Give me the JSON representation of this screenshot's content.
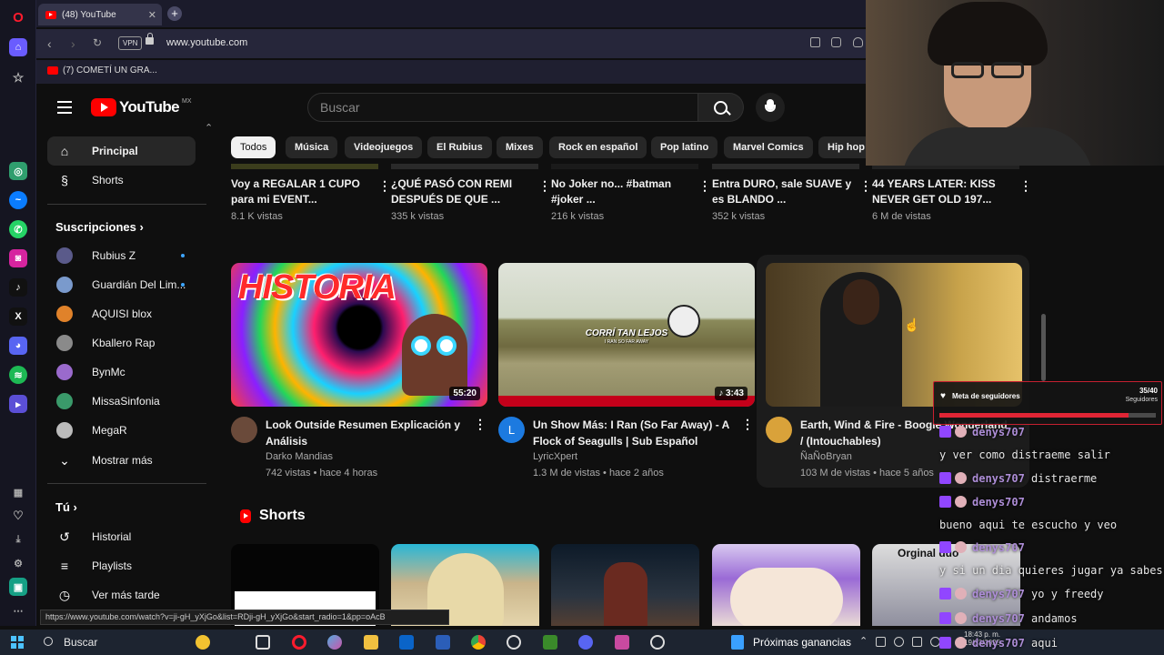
{
  "browser": {
    "tab_title": "(48) YouTube",
    "new_tab": "+",
    "vpn": "VPN",
    "url": "www.youtube.com",
    "bookmark": "(7) COMETÍ UN GRA...",
    "status_url": "https://www.youtube.com/watch?v=ji-gH_yXjGo&list=RDji-gH_yXjGo&start_radio=1&pp=oAcB"
  },
  "masthead": {
    "logo": "YouTube",
    "country": "MX",
    "search_placeholder": "Buscar"
  },
  "guide": {
    "home": "Principal",
    "shorts": "Shorts",
    "subs_header": "Suscripciones",
    "subscriptions": [
      {
        "name": "Rubius Z",
        "color": "#5a5a8a",
        "new": true
      },
      {
        "name": "Guardián Del Lim...",
        "color": "#7a9acc",
        "new": true
      },
      {
        "name": "AQUISI blox",
        "color": "#e0822a",
        "new": false
      },
      {
        "name": "Kballero Rap",
        "color": "#8a8a8a",
        "new": false
      },
      {
        "name": "BynMc",
        "color": "#9a6acc",
        "new": false
      },
      {
        "name": "MissaSinfonia",
        "color": "#3a9a6a",
        "new": false
      },
      {
        "name": "MegaR",
        "color": "#bbbbbb",
        "new": false
      }
    ],
    "show_more": "Mostrar más",
    "you_header": "Tú",
    "history": "Historial",
    "playlists": "Playlists",
    "watch_later": "Ver más tarde"
  },
  "chips": [
    "Todos",
    "Música",
    "Videojuegos",
    "El Rubius",
    "Mixes",
    "Rock en español",
    "Pop latino",
    "Marvel Comics",
    "Hip hop"
  ],
  "row1": [
    {
      "title": "Voy a REGALAR 1 CUPO para mi EVENT...",
      "meta": "8.1 K vistas"
    },
    {
      "title": "¿QUÉ PASÓ CON REMI DESPUÉS DE QUE ...",
      "meta": "335 k vistas"
    },
    {
      "title": "No Joker no... #batman #joker ...",
      "meta": "216 k vistas"
    },
    {
      "title": "Entra DURO, sale SUAVE y es BLANDO ...",
      "meta": "352 k vistas"
    },
    {
      "title": "44 YEARS LATER: KISS NEVER GET OLD 197...",
      "meta": "6 M de vistas"
    }
  ],
  "videos": [
    {
      "title": "Look Outside Resumen Explicación y Análisis",
      "channel": "Darko Mandias",
      "meta": "742 vistas • hace 4 horas",
      "duration": "55:20",
      "thumb_text": "HISTORIA"
    },
    {
      "title": "Un Show Más: I Ran (So Far Away) - A Flock of Seagulls | Sub Español",
      "channel": "LyricXpert",
      "meta": "1.3 M de vistas • hace 2 años",
      "duration": "♪ 3:43",
      "thumb_text": "CORRÍ TAN LEJOS",
      "thumb_sub": "I RAN SO FAR AWAY",
      "avatar_letter": "L"
    },
    {
      "title": "Earth, Wind & Fire - Boogie Wonderland / (Intouchables)",
      "channel": "ÑaÑoBryan",
      "meta": "103 M de vistas • hace 5 años"
    }
  ],
  "shorts_header": "Shorts",
  "shorts_overlay_text": "Orginal duo",
  "overlay": {
    "goal_label": "Meta de seguidores",
    "goal_count": "35/40",
    "goal_sub": "Seguidores",
    "goal_progress": 0.875
  },
  "chat": [
    {
      "user": "denys707",
      "msg": ""
    },
    {
      "user": "",
      "msg": "y ver como distraeme salir"
    },
    {
      "user": "denys707",
      "msg": "distraerme"
    },
    {
      "user": "denys707",
      "msg": ""
    },
    {
      "user": "",
      "msg": "bueno aqui te escucho y veo"
    },
    {
      "user": "denys707",
      "msg": ""
    },
    {
      "user": "",
      "msg": "y si un dia quieres jugar ya sabes"
    },
    {
      "user": "denys707",
      "msg": "yo y freedy"
    },
    {
      "user": "denys707",
      "msg": "andamos"
    },
    {
      "user": "denys707",
      "msg": "aqui"
    }
  ],
  "taskbar": {
    "search": "Buscar",
    "widget": "Próximas ganancias",
    "time": "18:43 p. m.",
    "date": "19/03/2025"
  }
}
